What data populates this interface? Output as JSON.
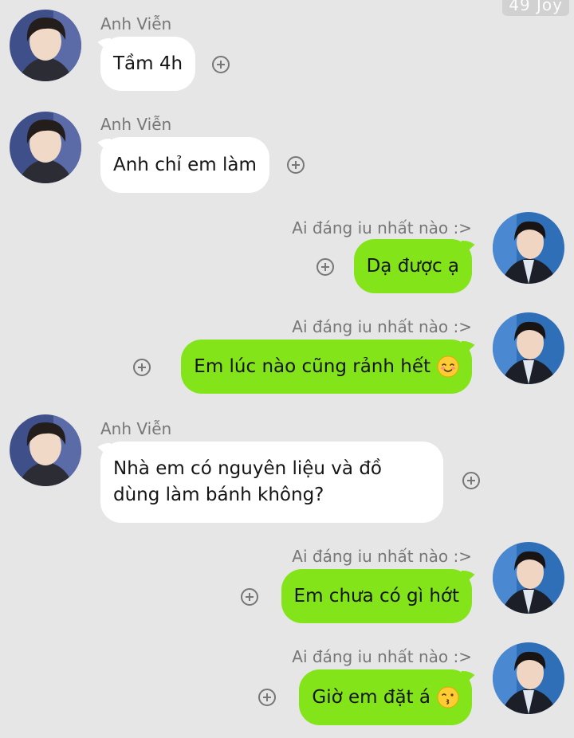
{
  "watermark": "49 Joy",
  "contacts": {
    "them": "Anh Viễn",
    "me": "Ai đáng iu nhất nào :>"
  },
  "messages": [
    {
      "from": "them",
      "text": "Tầm 4h"
    },
    {
      "from": "them",
      "text": "Anh chỉ em làm"
    },
    {
      "from": "me",
      "text": "Dạ được ạ"
    },
    {
      "from": "me",
      "text": "Em lúc nào cũng rảnh hết",
      "emoji": "smiling-blush-emoji"
    },
    {
      "from": "them",
      "text": "Nhà em có nguyên liệu và đồ dùng làm bánh không?"
    },
    {
      "from": "me",
      "text": "Em chưa có gì hớt"
    },
    {
      "from": "me",
      "text": "Giờ em đặt á",
      "emoji": "kissing-face-emoji"
    }
  ],
  "colors": {
    "background": "#e6e6e6",
    "incoming_bubble": "#ffffff",
    "outgoing_bubble": "#84e41a",
    "sender_text": "#777777"
  }
}
